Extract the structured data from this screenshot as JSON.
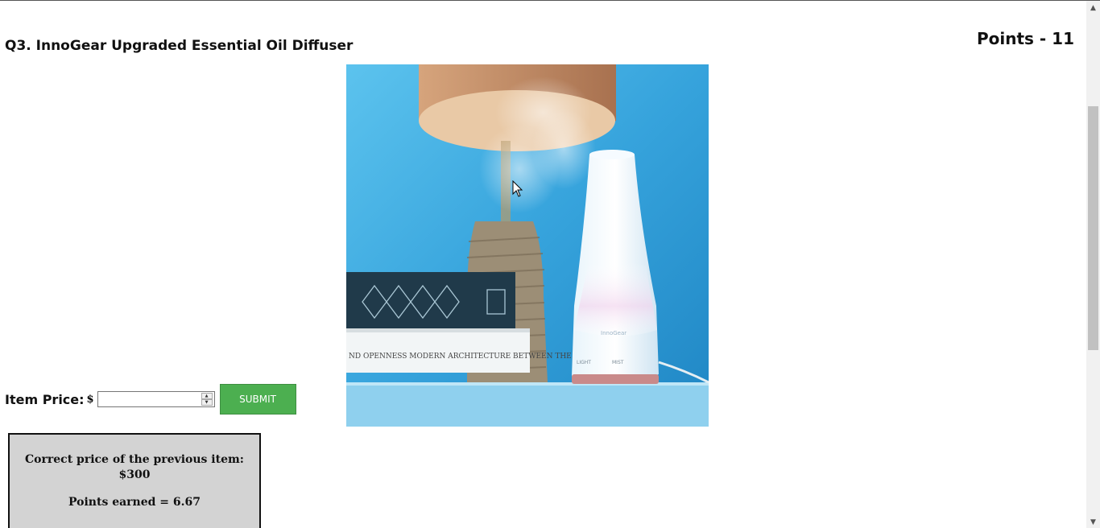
{
  "question": {
    "title": "Q3. InnoGear Upgraded Essential Oil Diffuser"
  },
  "points": {
    "label": "Points - 11"
  },
  "product_image": {
    "book_text": "ND OPENNESS  MODERN ARCHITECTURE BETWEEN THE WARS",
    "diffuser_buttons": [
      "LIGHT",
      "MIST"
    ],
    "diffuser_brand": "InnoGear"
  },
  "price_form": {
    "label": "Item Price:",
    "currency": "$",
    "value": "",
    "submit_label": "SUBMIT"
  },
  "result": {
    "line1": "Correct price of the previous item:",
    "line2": "$300",
    "points_earned": "Points earned = 6.67"
  },
  "icons": {
    "spinner_up": "spinner-up-icon",
    "spinner_down": "spinner-down-icon",
    "scroll_up": "scroll-up-icon",
    "scroll_down": "scroll-down-icon",
    "cursor": "mouse-pointer-icon"
  },
  "colors": {
    "submit_bg": "#4caf50",
    "result_bg": "#d3d3d3",
    "image_bg": "#3aa6dc"
  }
}
